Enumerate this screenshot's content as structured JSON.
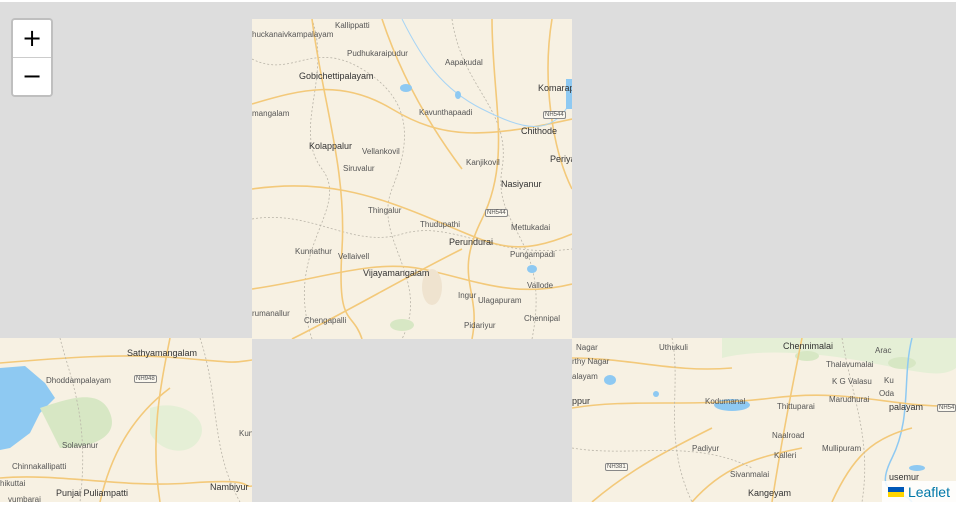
{
  "zoom": {
    "in_label": "+",
    "out_label": "−"
  },
  "attribution": {
    "link": "Leaflet",
    "flag_colors": [
      "#0057b7",
      "#ffd500"
    ]
  },
  "colors": {
    "background": "#dddddd",
    "land": "#f7f1e3",
    "water": "#8ec9f2",
    "park": "#d7e7c4",
    "road": "#f3c97a",
    "boundary": "#b9b4a8"
  },
  "tiles": {
    "top": {
      "labels": [
        {
          "text": "Kallippatti",
          "cls": ""
        },
        {
          "text": "huckanaivkampalayam",
          "cls": ""
        },
        {
          "text": "Pudhukaraipudur",
          "cls": ""
        },
        {
          "text": "Aapakudal",
          "cls": ""
        },
        {
          "text": "Gobichettipalayam",
          "cls": "town"
        },
        {
          "text": "Komarapa",
          "cls": "town"
        },
        {
          "text": "Kavunthapaadi",
          "cls": ""
        },
        {
          "text": "NH544",
          "cls": "shield"
        },
        {
          "text": "mangalam",
          "cls": ""
        },
        {
          "text": "Chithode",
          "cls": "town"
        },
        {
          "text": "Kolappalur",
          "cls": "town"
        },
        {
          "text": "Vellankovil",
          "cls": ""
        },
        {
          "text": "Periya",
          "cls": "town"
        },
        {
          "text": "Kanjikovil",
          "cls": ""
        },
        {
          "text": "Siruvalur",
          "cls": ""
        },
        {
          "text": "Nasiyanur",
          "cls": "town"
        },
        {
          "text": "Thingalur",
          "cls": ""
        },
        {
          "text": "NH544",
          "cls": "shield"
        },
        {
          "text": "Thudupathi",
          "cls": ""
        },
        {
          "text": "Mettukadai",
          "cls": ""
        },
        {
          "text": "Perundurai",
          "cls": "town"
        },
        {
          "text": "Kunnathur",
          "cls": ""
        },
        {
          "text": "Vellaivell",
          "cls": ""
        },
        {
          "text": "Pungampadi",
          "cls": ""
        },
        {
          "text": "Vijayamangalam",
          "cls": "town"
        },
        {
          "text": "Vallode",
          "cls": ""
        },
        {
          "text": "Ingur",
          "cls": ""
        },
        {
          "text": "Ulagapuram",
          "cls": ""
        },
        {
          "text": "rumanallur",
          "cls": ""
        },
        {
          "text": "Chengapalli",
          "cls": ""
        },
        {
          "text": "Pidariyur",
          "cls": ""
        },
        {
          "text": "Chennipal",
          "cls": ""
        }
      ]
    },
    "bottom_left": {
      "labels": [
        {
          "text": "Sathyamangalam",
          "cls": "town"
        },
        {
          "text": "Dhoddampalayam",
          "cls": ""
        },
        {
          "text": "NH948",
          "cls": "shield"
        },
        {
          "text": "Kun",
          "cls": ""
        },
        {
          "text": "Solavanur",
          "cls": ""
        },
        {
          "text": "Chinnakallipatti",
          "cls": ""
        },
        {
          "text": "hikuttai",
          "cls": ""
        },
        {
          "text": "Punjai Puliampatti",
          "cls": "town"
        },
        {
          "text": "Nambiyur",
          "cls": "town"
        },
        {
          "text": "vumbarai",
          "cls": ""
        }
      ]
    },
    "bottom_right": {
      "labels": [
        {
          "text": "Nagar",
          "cls": ""
        },
        {
          "text": "Uthukuli",
          "cls": ""
        },
        {
          "text": "Chennimalai",
          "cls": "town"
        },
        {
          "text": "Arac",
          "cls": ""
        },
        {
          "text": "rthy Nagar",
          "cls": ""
        },
        {
          "text": "Thalavumalai",
          "cls": ""
        },
        {
          "text": "alayam",
          "cls": ""
        },
        {
          "text": "K G Valasu",
          "cls": ""
        },
        {
          "text": "Ku",
          "cls": ""
        },
        {
          "text": "ppur",
          "cls": "town"
        },
        {
          "text": "Kodumanal",
          "cls": ""
        },
        {
          "text": "Thittuparai",
          "cls": ""
        },
        {
          "text": "Marudhurai",
          "cls": ""
        },
        {
          "text": "Oda",
          "cls": ""
        },
        {
          "text": "palayam",
          "cls": "town"
        },
        {
          "text": "NH54",
          "cls": "shield"
        },
        {
          "text": "Naalroad",
          "cls": ""
        },
        {
          "text": "Padiyur",
          "cls": ""
        },
        {
          "text": "Mullipuram",
          "cls": ""
        },
        {
          "text": "Kalleri",
          "cls": ""
        },
        {
          "text": "NH381",
          "cls": "shield"
        },
        {
          "text": "Sivanmalai",
          "cls": ""
        },
        {
          "text": "usemur",
          "cls": "town"
        },
        {
          "text": "Kangeyam",
          "cls": "town"
        }
      ]
    }
  }
}
